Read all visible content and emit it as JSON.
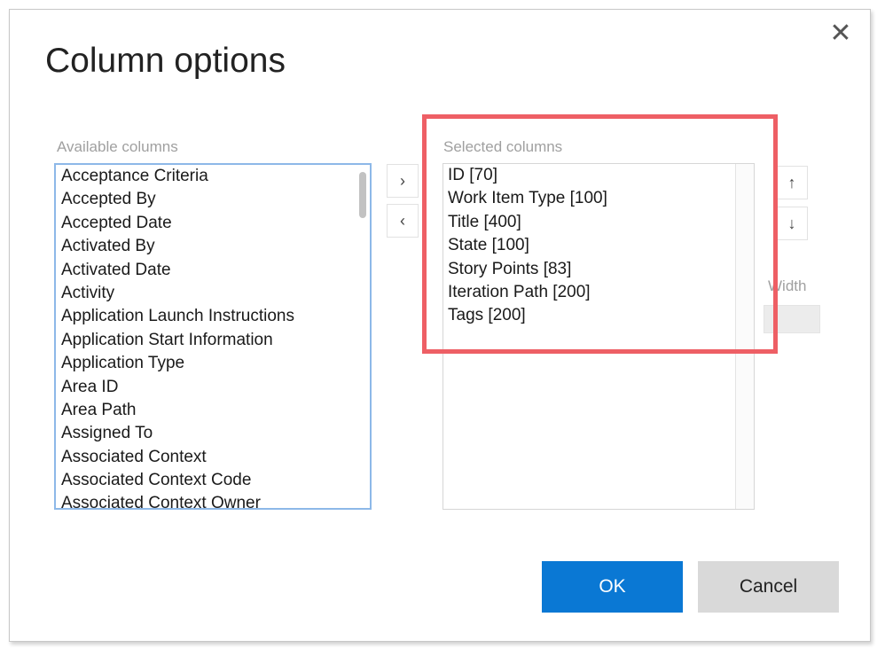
{
  "dialog": {
    "title": "Column options",
    "close_glyph": "✕",
    "close_icon": "close-icon"
  },
  "available": {
    "label": "Available columns",
    "items": [
      "Acceptance Criteria",
      "Accepted By",
      "Accepted Date",
      "Activated By",
      "Activated Date",
      "Activity",
      "Application Launch Instructions",
      "Application Start Information",
      "Application Type",
      "Area ID",
      "Area Path",
      "Assigned To",
      "Associated Context",
      "Associated Context Code",
      "Associated Context Owner"
    ]
  },
  "selected": {
    "label": "Selected columns",
    "items": [
      "ID [70]",
      "Work Item Type [100]",
      "Title [400]",
      "State [100]",
      "Story Points [83]",
      "Iteration Path [200]",
      "Tags [200]"
    ]
  },
  "transfer": {
    "add_glyph": "›",
    "remove_glyph": "‹"
  },
  "reorder": {
    "up_glyph": "↑",
    "down_glyph": "↓"
  },
  "width": {
    "label": "Width",
    "value": ""
  },
  "footer": {
    "ok_label": "OK",
    "cancel_label": "Cancel"
  },
  "colors": {
    "accent": "#0a78d4",
    "highlight": "#ee5f65",
    "focus_border": "#8db8e8"
  }
}
